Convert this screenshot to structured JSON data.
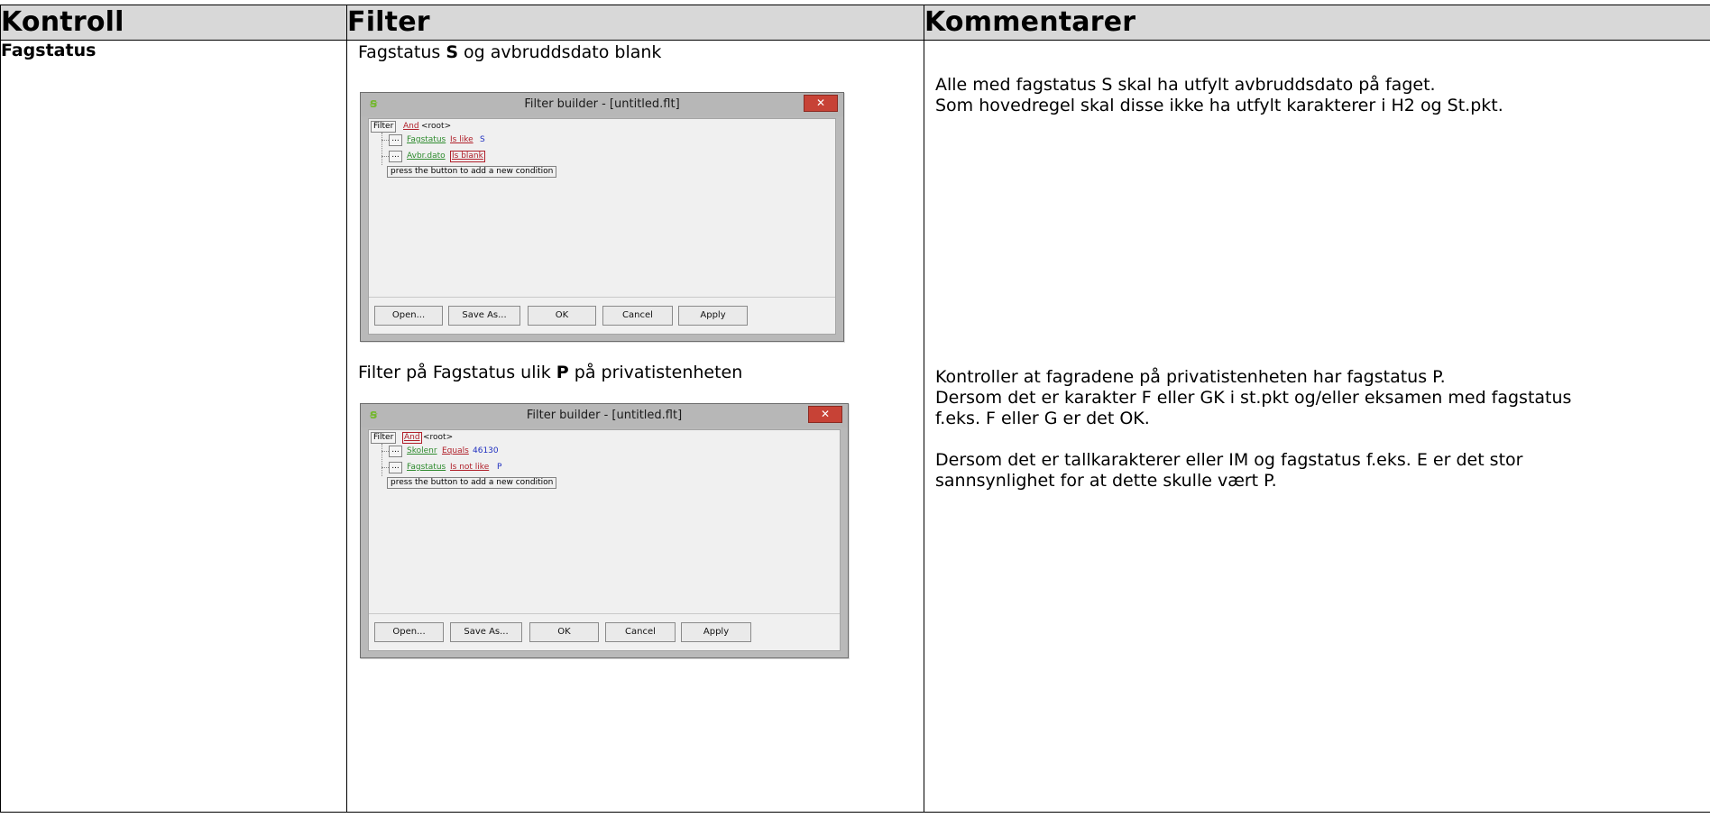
{
  "headers": {
    "kontroll": "Kontroll",
    "filter": "Filter",
    "kommentarer": "Kommentarer"
  },
  "kontroll": "Fagstatus",
  "section1": {
    "label_pre": "Fagstatus ",
    "label_bold": "S",
    "label_post": " og avbruddsdato blank",
    "comments": [
      "Alle med fagstatus S skal ha utfylt avbruddsdato på faget.",
      "Som hovedregel skal disse ikke ha utfylt karakterer i H2 og St.pkt."
    ],
    "dialog": {
      "title": "Filter builder - [untitled.flt]",
      "filter_chip": "Filter",
      "root_op": "And",
      "root_label": "<root>",
      "conditions": [
        {
          "ellipsis": "...",
          "field": "Fagstatus",
          "op": "Is like",
          "value": "S"
        },
        {
          "ellipsis": "...",
          "field": "Avbr.dato",
          "op": "Is blank",
          "value": ""
        }
      ],
      "hint": "press the button to add a new condition",
      "buttons": {
        "open": "Open...",
        "save_as": "Save As...",
        "ok": "OK",
        "cancel": "Cancel",
        "apply": "Apply"
      }
    }
  },
  "section2": {
    "label_pre": "Filter på Fagstatus ulik ",
    "label_bold": "P",
    "label_post": " på privatistenheten",
    "comments": [
      "Kontroller at fagradene på privatistenheten har fagstatus P.",
      "Dersom det er karakter F eller GK i st.pkt og/eller eksamen med fagstatus",
      "f.eks. F eller G er det OK.",
      "",
      "Dersom det er tallkarakterer eller IM og fagstatus f.eks. E er det stor",
      "sannsynlighet for at dette skulle vært P."
    ],
    "dialog": {
      "title": "Filter builder - [untitled.flt]",
      "filter_chip": "Filter",
      "root_op": "And",
      "root_label": "<root>",
      "conditions": [
        {
          "ellipsis": "...",
          "field": "Skolenr",
          "op": "Equals",
          "value": "46130"
        },
        {
          "ellipsis": "...",
          "field": "Fagstatus",
          "op": "Is not like",
          "value": "P"
        }
      ],
      "hint": "press the button to add a new condition",
      "buttons": {
        "open": "Open...",
        "save_as": "Save As...",
        "ok": "OK",
        "cancel": "Cancel",
        "apply": "Apply"
      }
    }
  },
  "colors": {
    "header_bg": "#d8d8d8",
    "close_button": "#c74236",
    "field_green": "#2e8b2e",
    "operator_red": "#b0202a",
    "value_blue": "#2030c0"
  }
}
